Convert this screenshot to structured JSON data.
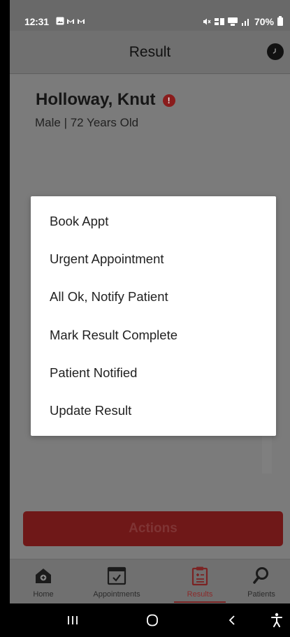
{
  "status_bar": {
    "time": "12:31",
    "battery": "70%"
  },
  "app_bar": {
    "title": "Result"
  },
  "patient": {
    "name": "Holloway, Knut",
    "alert_icon": "!",
    "meta": "Male | 72 Years Old"
  },
  "menu": {
    "items": [
      {
        "label": "Book Appt"
      },
      {
        "label": "Urgent Appointment"
      },
      {
        "label": "All Ok, Notify Patient"
      },
      {
        "label": "Mark Result Complete"
      },
      {
        "label": "Patient Notified"
      },
      {
        "label": "Update Result"
      }
    ]
  },
  "actions": {
    "label": "Actions"
  },
  "bottom_nav": {
    "items": [
      {
        "label": "Home",
        "icon": "home-icon"
      },
      {
        "label": "Appointments",
        "icon": "calendar-icon"
      },
      {
        "label": "Results",
        "icon": "clipboard-icon",
        "active": true
      },
      {
        "label": "Patients",
        "icon": "search-icon"
      }
    ]
  },
  "colors": {
    "brand_red": "#8a1c1c",
    "dim_overlay": "#7b7b7b",
    "menu_bg": "#ffffff"
  }
}
